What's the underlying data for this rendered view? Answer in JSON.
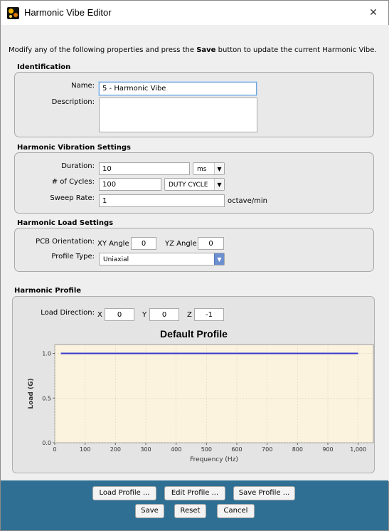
{
  "window": {
    "title": "Harmonic Vibe Editor",
    "close_glyph": "✕"
  },
  "instructions": {
    "prefix": "Modify any of the following properties and press the ",
    "bold": "Save",
    "suffix": " button to update the current Harmonic Vibe."
  },
  "identification": {
    "heading": "Identification",
    "name_label": "Name:",
    "name_value": "5 - Harmonic Vibe",
    "description_label": "Description:",
    "description_value": ""
  },
  "vibration": {
    "heading": "Harmonic Vibration Settings",
    "duration_label": "Duration:",
    "duration_value": "10",
    "duration_unit": "ms",
    "cycles_label": "# of Cycles:",
    "cycles_value": "100",
    "cycles_mode": "DUTY CYCLE",
    "sweep_label": "Sweep Rate:",
    "sweep_value": "1",
    "sweep_unit": "octave/min"
  },
  "load": {
    "heading": "Harmonic Load Settings",
    "pcb_label": "PCB Orientation:",
    "xy_label": "XY Angle",
    "xy_value": "0",
    "yz_label": "YZ Angle",
    "yz_value": "0",
    "profile_type_label": "Profile Type:",
    "profile_type_value": "Uniaxial"
  },
  "profile": {
    "heading": "Harmonic Profile",
    "load_direction_label": "Load Direction:",
    "x_label": "X",
    "x_value": "0",
    "y_label": "Y",
    "y_value": "0",
    "z_label": "Z",
    "z_value": "-1"
  },
  "chart_data": {
    "type": "line",
    "title": "Default Profile",
    "xlabel": "Frequency (Hz)",
    "ylabel": "Load (G)",
    "xlim": [
      0,
      1050
    ],
    "ylim": [
      0,
      1.1
    ],
    "x_ticks": [
      0,
      100,
      200,
      300,
      400,
      500,
      600,
      700,
      800,
      900,
      1000
    ],
    "x_tick_labels": [
      "0",
      "100",
      "200",
      "300",
      "400",
      "500",
      "600",
      "700",
      "800",
      "900",
      "1,000"
    ],
    "y_ticks": [
      0,
      0.5,
      1
    ],
    "y_tick_labels": [
      "0.0",
      "0.5",
      "1.0"
    ],
    "grid": true,
    "series": [
      {
        "x": [
          20,
          1000
        ],
        "y": [
          1,
          1
        ],
        "color": "#3a3ad0"
      }
    ],
    "plot_bg": "#fbf3de"
  },
  "buttons": {
    "load_profile": "Load Profile ...",
    "edit_profile": "Edit Profile ...",
    "save_profile": "Save Profile ...",
    "save": "Save",
    "reset": "Reset",
    "cancel": "Cancel"
  },
  "colors": {
    "footer": "#2f6f93",
    "accent": "#3a3ad0"
  }
}
